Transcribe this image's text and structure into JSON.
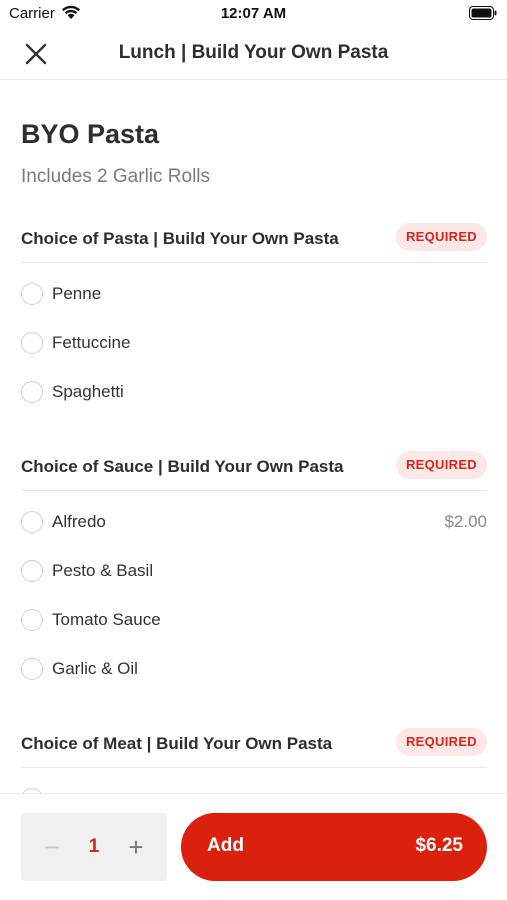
{
  "status_bar": {
    "carrier": "Carrier",
    "time": "12:07 AM"
  },
  "nav": {
    "title": "Lunch | Build Your Own Pasta",
    "close_icon": "close-icon"
  },
  "item": {
    "title": "BYO Pasta",
    "subtitle": "Includes 2 Garlic Rolls"
  },
  "sections": [
    {
      "title": "Choice of Pasta | Build Your Own Pasta",
      "badge": "REQUIRED",
      "options": [
        {
          "label": "Penne",
          "price": ""
        },
        {
          "label": "Fettuccine",
          "price": ""
        },
        {
          "label": "Spaghetti",
          "price": ""
        }
      ]
    },
    {
      "title": "Choice of Sauce | Build Your Own Pasta",
      "badge": "REQUIRED",
      "options": [
        {
          "label": "Alfredo",
          "price": "$2.00"
        },
        {
          "label": "Pesto & Basil",
          "price": ""
        },
        {
          "label": "Tomato Sauce",
          "price": ""
        },
        {
          "label": "Garlic & Oil",
          "price": ""
        }
      ]
    },
    {
      "title": "Choice of Meat | Build Your Own Pasta",
      "badge": "REQUIRED",
      "options": []
    }
  ],
  "bottom": {
    "qty_minus": "−",
    "quantity": "1",
    "qty_plus": "+",
    "add_label": "Add",
    "add_price": "$6.25"
  },
  "colors": {
    "accent": "#d9210e",
    "badge_bg": "#fde8e8",
    "badge_text": "#d9241a"
  }
}
